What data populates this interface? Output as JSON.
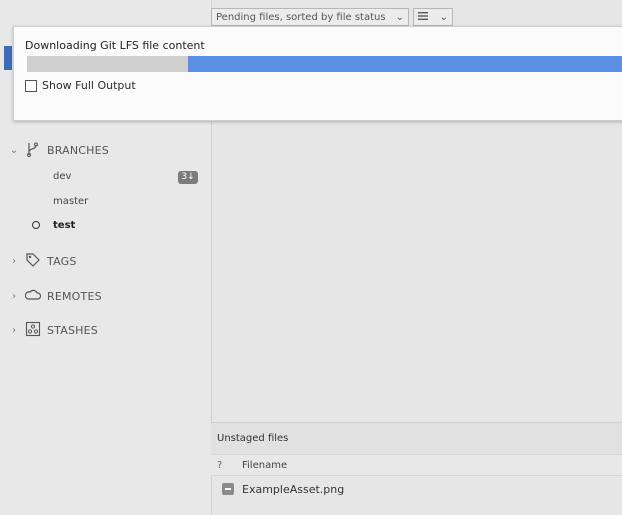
{
  "dialog": {
    "title": "Downloading Git LFS file content",
    "progress": 0.27,
    "show_full_output_label": "Show Full Output"
  },
  "filters": {
    "pending_label": "Pending files, sorted by file status",
    "pending_chevron": "⌄",
    "view_icon": "list-view-icon",
    "view_chevron": "⌄"
  },
  "sidebar": {
    "branches_label": "BRANCHES",
    "branches": [
      {
        "name": "dev",
        "badge": "3↓"
      },
      {
        "name": "master"
      },
      {
        "name": "test",
        "current": true
      }
    ],
    "tags_label": "TAGS",
    "remotes_label": "REMOTES",
    "stashes_label": "STASHES"
  },
  "unstaged": {
    "title": "Unstaged files",
    "col_status": "?",
    "col_filename": "Filename",
    "files": [
      {
        "name": "ExampleAsset.png",
        "status_icon": "removed-file-icon"
      }
    ]
  },
  "colors": {
    "accent_blue": "#5b8fe3",
    "sidebar_tab_blue": "#3d6db6"
  }
}
